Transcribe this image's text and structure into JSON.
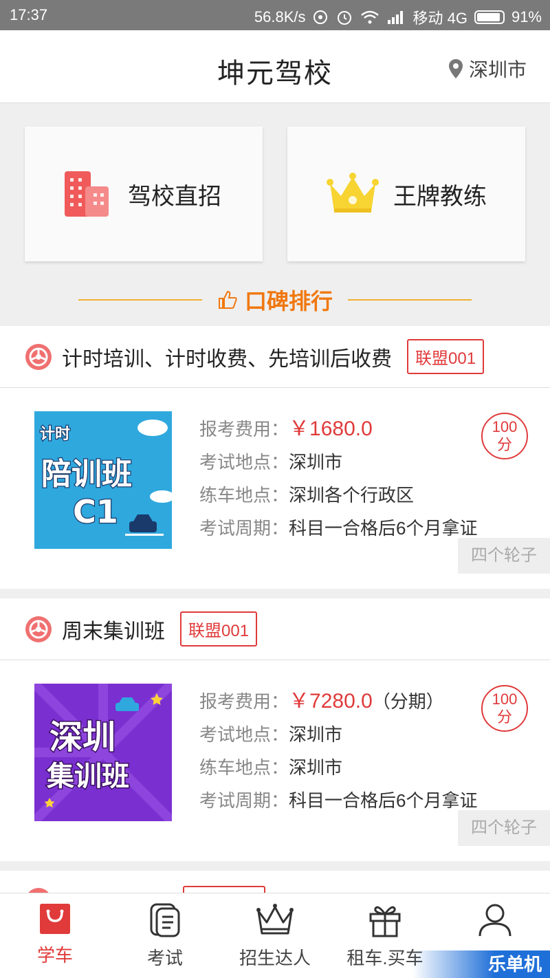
{
  "status_bar": {
    "time": "17:37",
    "network_speed": "56.8K/s",
    "carrier": "移动 4G",
    "battery": "91%",
    "battery_level": 0.91
  },
  "header": {
    "title": "坤元驾校",
    "location": "深圳市"
  },
  "features": [
    {
      "label": "驾校直招",
      "icon": "building-icon"
    },
    {
      "label": "王牌教练",
      "icon": "crown-icon"
    }
  ],
  "ranking": {
    "label": "口碑排行"
  },
  "field_labels": {
    "fee": "报考费用：",
    "exam_location": "考试地点：",
    "practice_location": "练车地点：",
    "exam_period": "考试周期："
  },
  "courses": [
    {
      "name": "计时培训、计时收费、先培训后收费",
      "badge": "联盟001",
      "fee": "￥1680.0",
      "fee_note": "",
      "exam_location": "深圳市",
      "practice_location": "深圳各个行政区",
      "exam_period": "科目一合格后6个月拿证",
      "score_value": "100",
      "score_unit": "分",
      "school": "四个轮子",
      "thumb": {
        "line1": "计时",
        "line2": "陪训班",
        "line3": "C1"
      }
    },
    {
      "name": "周末集训班",
      "badge": "联盟001",
      "fee": "￥7280.0",
      "fee_note": "（分期）",
      "exam_location": "深圳市",
      "practice_location": "深圳市",
      "exam_period": "科目一合格后6个月拿证",
      "score_value": "100",
      "score_unit": "分",
      "school": "四个轮子",
      "thumb": {
        "line1": "深圳",
        "line2": "集训班"
      }
    }
  ],
  "bottom_nav": [
    {
      "label": "学车",
      "icon": "bag-icon",
      "active": true
    },
    {
      "label": "考试",
      "icon": "document-icon",
      "active": false
    },
    {
      "label": "招生达人",
      "icon": "crown-outline-icon",
      "active": false
    },
    {
      "label": "租车.买车",
      "icon": "gift-icon",
      "active": false
    },
    {
      "label": "",
      "icon": "user-icon",
      "active": false
    }
  ],
  "watermark": "乐单机",
  "colors": {
    "accent": "#e03a3a",
    "ranking": "#f07810"
  }
}
